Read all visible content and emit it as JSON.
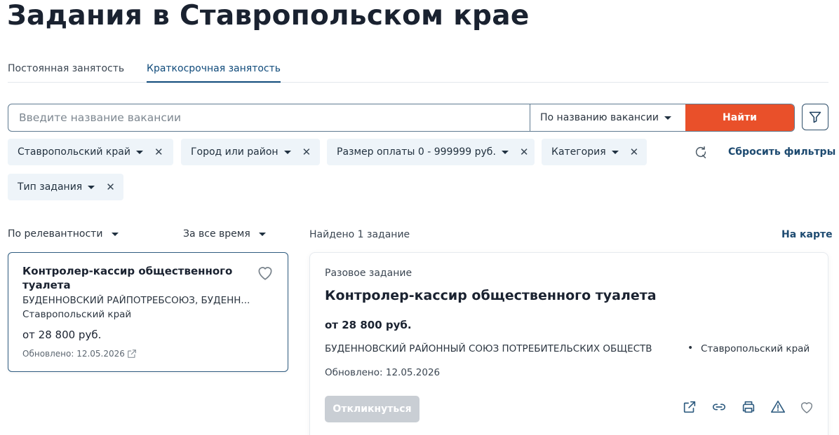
{
  "page": {
    "title": "Задания в Ставропольском крае"
  },
  "tabs": [
    {
      "label": "Постоянная занятость",
      "active": false
    },
    {
      "label": "Краткосрочная занятость",
      "active": true
    }
  ],
  "search": {
    "placeholder": "Введите название вакансии",
    "value": "",
    "mode": "По названию вакансии",
    "button_label": "Найти"
  },
  "filters": [
    {
      "label": "Ставропольский край"
    },
    {
      "label": "Город или район"
    },
    {
      "label": "Размер оплаты 0 - 999999 руб."
    },
    {
      "label": "Категория"
    },
    {
      "label": "Тип задания"
    }
  ],
  "reset_label": "Сбросить фильтры",
  "sort": {
    "relevance": "По релевантности",
    "period": "За все время"
  },
  "results": {
    "found_text": "Найдено 1 задание",
    "map_link": "На карте"
  },
  "list_card": {
    "title": "Контролер-кассир общественного туалета",
    "org": "БУДЕННОВСКИЙ РАЙПОТРЕБСОЮЗ, БУДЕНН...",
    "region": "Ставропольский край",
    "salary": "от 28 800 руб.",
    "updated": "Обновлено: 12.05.2026"
  },
  "detail": {
    "type": "Разовое задание",
    "title": "Контролер-кассир общественного туалета",
    "salary": "от 28 800 руб.",
    "org": "БУДЕННОВСКИЙ РАЙОННЫЙ СОЮЗ ПОТРЕБИТЕЛЬСКИХ ОБЩЕСТВ",
    "separator": "•",
    "region": "Ставропольский край",
    "updated": "Обновлено: 12.05.2026",
    "respond_label": "Откликнуться"
  },
  "icons": {
    "filter": "filter-icon",
    "reset": "refresh-icon",
    "heart": "heart-icon",
    "external": "external-link-icon",
    "link": "link-icon",
    "print": "print-icon",
    "warning": "warning-icon"
  },
  "colors": {
    "accent": "#e9502a",
    "brand": "#1d4a70",
    "chip_bg": "#eef4f9",
    "disabled_btn": "#c9ced4"
  }
}
